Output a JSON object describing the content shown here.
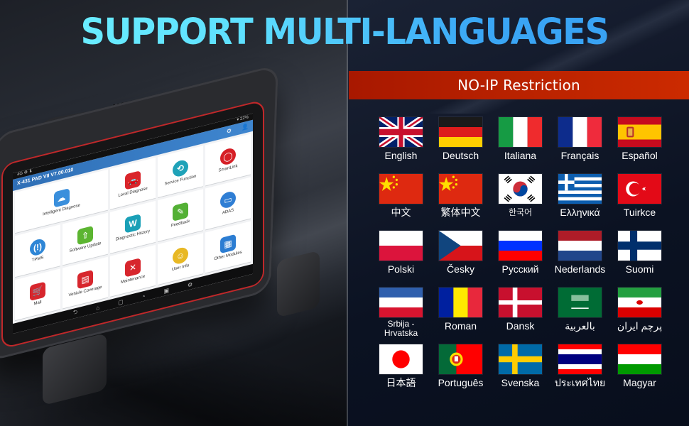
{
  "headline": "SUPPORT MULTI-LANGUAGES",
  "banner": "NO-IP Restriction",
  "colors": {
    "headline_gradient_start": "#6ff2ff",
    "headline_gradient_end": "#38a0f2",
    "banner": "#b92200",
    "panel_bg": "#0b1222"
  },
  "languages": [
    {
      "label": "English",
      "flag": "uk-flag"
    },
    {
      "label": "Deutsch",
      "flag": "germany-flag"
    },
    {
      "label": "Italiana",
      "flag": "italy-flag"
    },
    {
      "label": "Français",
      "flag": "france-flag"
    },
    {
      "label": "Español",
      "flag": "spain-flag"
    },
    {
      "label": "中文",
      "flag": "china-flag"
    },
    {
      "label": "繁体中文",
      "flag": "china-flag"
    },
    {
      "label": "한국어",
      "flag": "south-korea-flag"
    },
    {
      "label": "Ελληνικά",
      "flag": "greece-flag"
    },
    {
      "label": "Tuirkce",
      "flag": "turkey-flag"
    },
    {
      "label": "Polski",
      "flag": "poland-flag"
    },
    {
      "label": "Česky",
      "flag": "czech-flag"
    },
    {
      "label": "Русский",
      "flag": "russia-flag"
    },
    {
      "label": "Nederlands",
      "flag": "netherlands-flag"
    },
    {
      "label": "Suomi",
      "flag": "finland-flag"
    },
    {
      "label": "Srbija - Hrvatska",
      "flag": "serbia-croatia-flag"
    },
    {
      "label": "Roman",
      "flag": "romania-flag"
    },
    {
      "label": "Dansk",
      "flag": "denmark-flag"
    },
    {
      "label": "بالعربية",
      "flag": "saudi-arabia-flag"
    },
    {
      "label": "پرچم ایران",
      "flag": "iran-flag"
    },
    {
      "label": "日本語",
      "flag": "japan-flag"
    },
    {
      "label": "Português",
      "flag": "portugal-flag"
    },
    {
      "label": "Svenska",
      "flag": "sweden-flag"
    },
    {
      "label": "ประเทศไทย",
      "flag": "thailand-flag"
    },
    {
      "label": "Magyar",
      "flag": "hungary-flag"
    }
  ],
  "tablet": {
    "status_left": "4G ⚙ ⬇",
    "status_right": "▾ 22%",
    "app_title": "X-431 PAD VII V7.00.010",
    "tiles": [
      {
        "label": "Intelligent Diagnose",
        "icon": "cloud-share-icon",
        "color": "#3a8fdc",
        "glyph": "☁",
        "big": true
      },
      {
        "label": "Local Diagnose",
        "icon": "mechanic-car-icon",
        "color": "#d9252b",
        "glyph": "🚗"
      },
      {
        "label": "Service Function",
        "icon": "wrench-circle-icon",
        "color": "#1fa2b8",
        "glyph": "⟲",
        "round": true
      },
      {
        "label": "SmartLink",
        "icon": "smartlink-icon",
        "color": "#d61f26",
        "glyph": "◯",
        "round": true
      },
      {
        "label": "TPMS",
        "icon": "tire-pressure-icon",
        "color": "#2e86d6",
        "glyph": "(!)",
        "round": true
      },
      {
        "label": "Software Update",
        "icon": "upload-icon",
        "color": "#5cb531",
        "glyph": "⇧"
      },
      {
        "label": "Diagnostic History",
        "icon": "clipboard-icon",
        "color": "#1aa0b7",
        "glyph": "W"
      },
      {
        "label": "Feedback",
        "icon": "feedback-icon",
        "color": "#53b035",
        "glyph": "✎"
      },
      {
        "label": "ADAS",
        "icon": "adas-icon",
        "color": "#2f7ed4",
        "glyph": "▭",
        "round": true
      },
      {
        "label": "Mall",
        "icon": "cart-icon",
        "color": "#d7262d",
        "glyph": "🛒"
      },
      {
        "label": "Vehicle Coverage",
        "icon": "vehicle-coverage-icon",
        "color": "#d7262d",
        "glyph": "▤"
      },
      {
        "label": "Maintenance",
        "icon": "tools-icon",
        "color": "#d7262d",
        "glyph": "✕"
      },
      {
        "label": "User Info",
        "icon": "user-info-icon",
        "color": "#e8b824",
        "glyph": "☺",
        "round": true
      },
      {
        "label": "Other Modules",
        "icon": "modules-icon",
        "color": "#2c7dd2",
        "glyph": "▦"
      }
    ],
    "nav": [
      "⮌",
      "⌂",
      "▢",
      "◔",
      "▣",
      "⚙"
    ]
  }
}
